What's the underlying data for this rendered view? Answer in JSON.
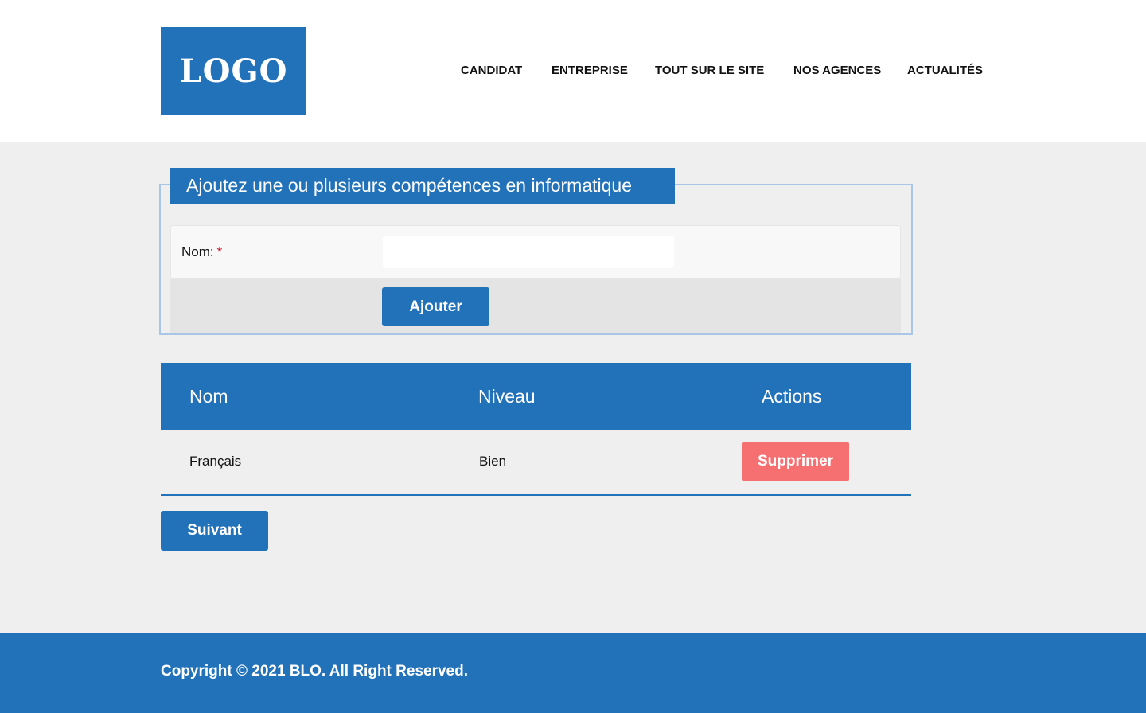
{
  "header": {
    "logo_text": "LOGO",
    "nav": [
      "CANDIDAT",
      "ENTREPRISE",
      "TOUT SUR LE SITE",
      "NOS AGENCES",
      "ACTUALITÉS"
    ]
  },
  "form": {
    "legend": "Ajoutez une ou plusieurs compétences en informatique",
    "label": "Nom:",
    "required_mark": "*",
    "input_value": "",
    "input_placeholder": "",
    "submit_label": "Ajouter"
  },
  "table": {
    "headers": [
      "Nom",
      "Niveau",
      "Actions"
    ],
    "rows": [
      {
        "nom": "Français",
        "niveau": "Bien",
        "action_label": "Supprimer"
      }
    ]
  },
  "next_label": "Suivant",
  "footer": {
    "copyright": "Copyright © 2021 BLO. All Right Reserved."
  },
  "colors": {
    "primary": "#2272ba",
    "danger": "#f67072",
    "background": "#efefef",
    "required": "#d0021b"
  }
}
